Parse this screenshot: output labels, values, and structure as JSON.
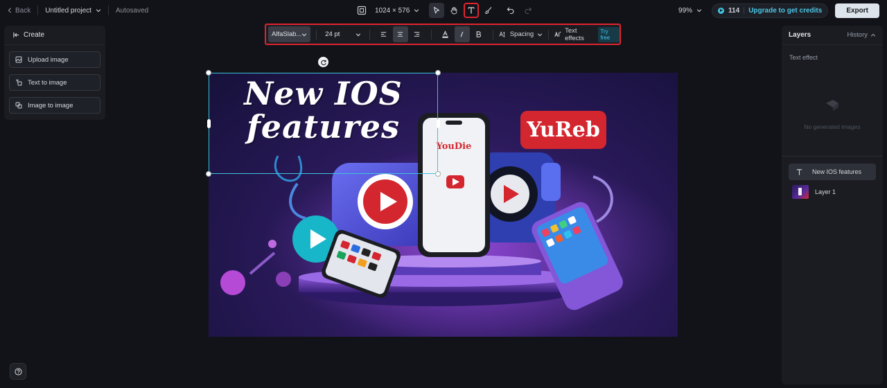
{
  "topbar": {
    "back_label": "Back",
    "project_name": "Untitled project",
    "autosave_status": "Autosaved",
    "canvas_size": "1024 × 576",
    "zoom": "99%",
    "credits_count": "114",
    "upgrade_label": "Upgrade to get credits",
    "export_label": "Export"
  },
  "create_panel": {
    "title": "Create",
    "items": [
      {
        "label": "Upload image",
        "icon": "upload-image-icon"
      },
      {
        "label": "Text to image",
        "icon": "text-to-image-icon"
      },
      {
        "label": "Image to image",
        "icon": "image-to-image-icon"
      }
    ]
  },
  "text_toolbar": {
    "font": "AlfaSlab...",
    "size": "24 pt",
    "spacing_label": "Spacing",
    "text_effects_label": "Text effects",
    "try_free_label": "Try free"
  },
  "canvas": {
    "headline_line1": "New IOS",
    "headline_line2": "features",
    "phone_brand": "YouDie",
    "badge_text": "YuReb"
  },
  "layers_panel": {
    "title": "Layers",
    "history_label": "History",
    "section_label": "Text effect",
    "empty_message": "No generated images",
    "layers": [
      {
        "label": "New IOS features",
        "type": "text",
        "selected": true
      },
      {
        "label": "Layer 1",
        "type": "image",
        "selected": false
      }
    ]
  },
  "colors": {
    "background": "#121318",
    "panel": "#1a1c22",
    "accent": "#4dc7e6",
    "selection": "#3cc3df",
    "highlight_red": "#e0242f"
  }
}
